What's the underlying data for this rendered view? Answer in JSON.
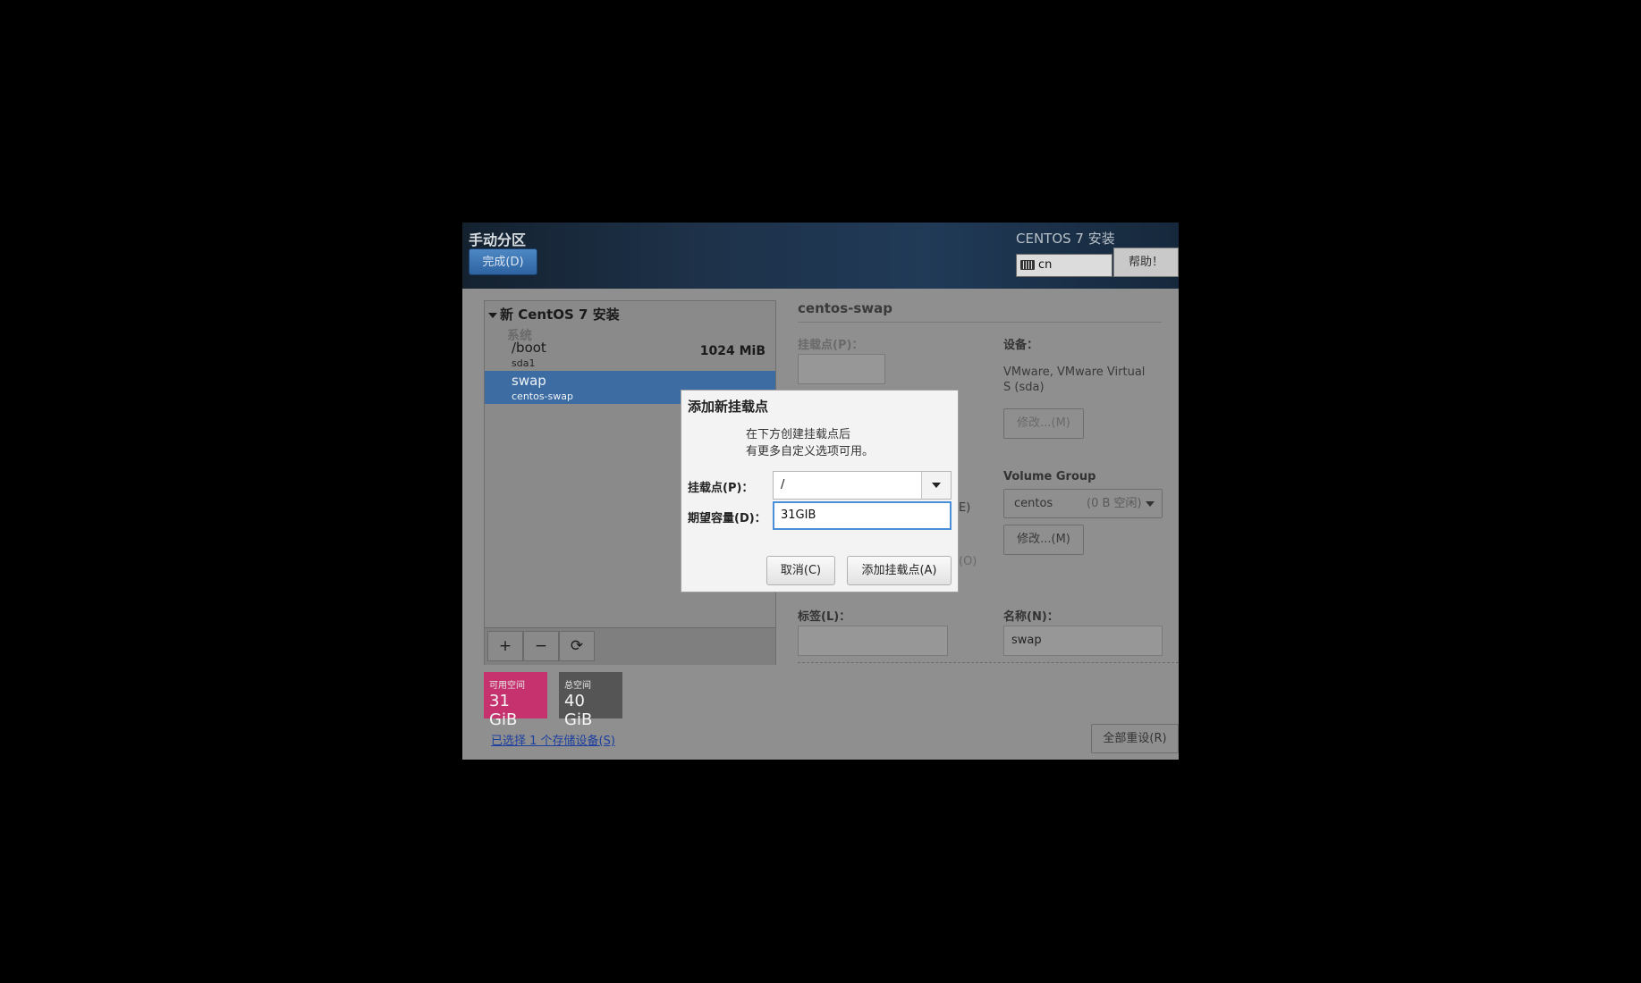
{
  "header": {
    "title": "手动分区",
    "done_button": "完成(D)",
    "product": "CENTOS 7 安装",
    "keyboard_layout": "cn",
    "help_button": "帮助！"
  },
  "partitions": {
    "root_title": "新 CentOS 7 安装",
    "group_label": "系统",
    "items": [
      {
        "name": "/boot",
        "device": "sda1",
        "size": "1024 MiB",
        "selected": false
      },
      {
        "name": "swap",
        "device": "centos-swap",
        "size": "",
        "selected": true
      }
    ],
    "tools": {
      "add": "+",
      "remove": "−",
      "refresh": "⟳"
    }
  },
  "space": {
    "available_label": "可用空间",
    "available_value": "31 GiB",
    "available_color": "#c6326e",
    "total_label": "总空间",
    "total_value": "40 GiB",
    "total_color": "#555555"
  },
  "storage_link": "已选择 1 个存储设备(S)",
  "details": {
    "title": "centos-swap",
    "mount_point_label": "挂载点(P)：",
    "mount_point_value": "",
    "device_label": "设备：",
    "device_value": "VMware, VMware Virtual S (sda)",
    "modify_button_1": "修改...(M)",
    "volume_group_label": "Volume Group",
    "volume_group_value": "centos",
    "volume_group_free": "(0 B 空闲)",
    "modify_button_2": "修改...(M)",
    "partial_text_1": "E)",
    "partial_text_2": "(O)",
    "label_label": "标签(L)：",
    "label_value": "",
    "name_label": "名称(N)：",
    "name_value": "swap"
  },
  "reset_button": "全部重设(R)",
  "dialog": {
    "title": "添加新挂载点",
    "desc_line1": "在下方创建挂载点后",
    "desc_line2": "有更多自定义选项可用。",
    "mount_label": "挂载点(P)：",
    "mount_value": "/",
    "capacity_label": "期望容量(D)：",
    "capacity_value": "31GIB",
    "cancel_button": "取消(C)",
    "add_button": "添加挂载点(A)"
  }
}
